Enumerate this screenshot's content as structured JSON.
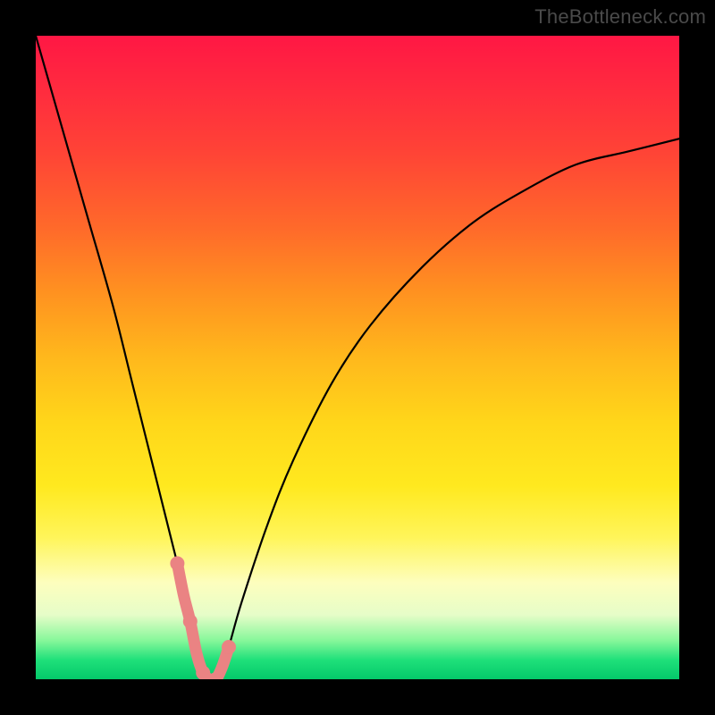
{
  "attribution": "TheBottleneck.com",
  "chart_data": {
    "type": "line",
    "title": "",
    "xlabel": "",
    "ylabel": "",
    "xlim": [
      0,
      100
    ],
    "ylim": [
      0,
      100
    ],
    "series": [
      {
        "name": "bottleneck-curve",
        "x": [
          0,
          4,
          8,
          12,
          15,
          18,
          20,
          22,
          24,
          25,
          26,
          27,
          28,
          29,
          30,
          32,
          36,
          40,
          46,
          52,
          60,
          68,
          76,
          84,
          92,
          100
        ],
        "values": [
          100,
          86,
          72,
          58,
          46,
          34,
          26,
          18,
          10,
          5,
          2,
          0,
          0,
          2,
          5,
          12,
          24,
          34,
          46,
          55,
          64,
          71,
          76,
          80,
          82,
          84
        ]
      }
    ],
    "markers": {
      "name": "highlighted-range",
      "x": [
        22,
        23,
        24,
        25,
        26,
        27,
        28,
        29,
        30
      ],
      "values": [
        18,
        13,
        9,
        4,
        1,
        0,
        0,
        2,
        5
      ]
    },
    "colors": {
      "curve": "#000000",
      "marker": "#ea8383",
      "gradient_top": "#ff1744",
      "gradient_bottom": "#04c96a"
    }
  }
}
